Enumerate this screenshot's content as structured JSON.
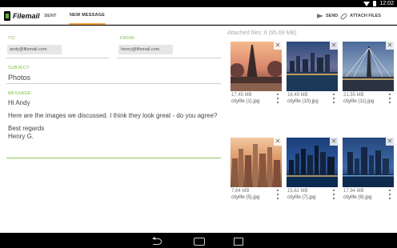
{
  "status_bar": {
    "time": "12:02"
  },
  "app": {
    "name": "Filemail"
  },
  "tabs": [
    {
      "label": "SENT",
      "active": false
    },
    {
      "label": "NEW MESSAGE",
      "active": true
    }
  ],
  "actions": {
    "send": "SEND",
    "attach": "ATTACH FILES"
  },
  "form": {
    "to_label": "TO:",
    "to_value": "andy@filemail.com",
    "from_label": "FROM:",
    "from_value": "henry@filemail.com",
    "subject_label": "SUBJECT:",
    "subject_value": "Photos",
    "message_label": "MESSAGE:",
    "message_lines": [
      "Hi Andy",
      "Here are the images we discussed. I think they look great - do you agree?",
      "Best regards",
      "Henry G."
    ]
  },
  "attachments": {
    "summary": "Attached files: 6 (95.69 MB)",
    "files": [
      {
        "size": "17.45 MB",
        "name": "citylife (1).jpg",
        "theme": "paris"
      },
      {
        "size": "16.49 MB",
        "name": "citylife (10).jpg",
        "theme": "harbor-night"
      },
      {
        "size": "21.55 MB",
        "name": "citylife (11).jpg",
        "theme": "bridge-dusk"
      },
      {
        "size": "7.64 MB",
        "name": "citylife (5).jpg",
        "theme": "city-sunset"
      },
      {
        "size": "15.62 MB",
        "name": "citylife (7).jpg",
        "theme": "skyline-night"
      },
      {
        "size": "17.94 MB",
        "name": "citylife (9).jpg",
        "theme": "towers-blue"
      }
    ]
  },
  "colors": {
    "accent_green": "#7bbf3e",
    "tab_indicator": "#f2a33a"
  }
}
